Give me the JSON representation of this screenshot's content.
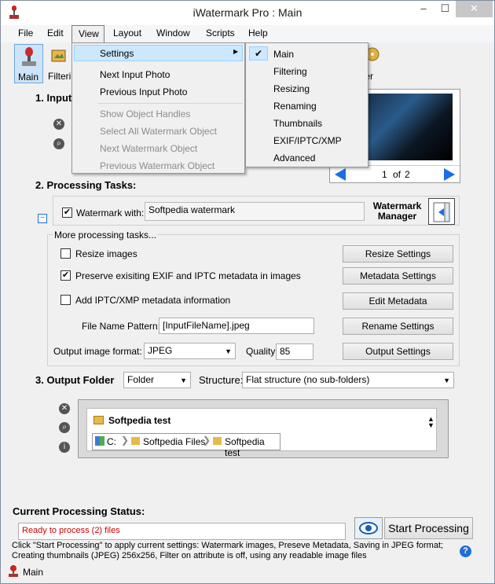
{
  "window": {
    "title": "iWatermark Pro : Main",
    "minimize": "–",
    "maximize": "☐",
    "close": "✕"
  },
  "menu": [
    "File",
    "Edit",
    "View",
    "Layout",
    "Window",
    "Scripts",
    "Help"
  ],
  "toolbar": {
    "main": "Main",
    "filtering": "Filteri",
    "master": "ster"
  },
  "view_menu": {
    "settings": "Settings",
    "next_input": "Next Input Photo",
    "prev_input": "Previous Input Photo",
    "show_handles": "Show Object Handles",
    "select_all": "Select All Watermark Object",
    "next_wm": "Next Watermark Object",
    "prev_wm": "Previous Watermark Object"
  },
  "settings_submenu": [
    "Main",
    "Filtering",
    "Resizing",
    "Renaming",
    "Thumbnails",
    "EXIF/IPTC/XMP",
    "Advanced"
  ],
  "settings_checked": "Main",
  "section1": {
    "title": "1. Input",
    "page": "1",
    "of": "of",
    "total": "2"
  },
  "section2": {
    "title": "2. Processing Tasks:",
    "watermark_label": "Watermark with:",
    "watermark_value": "Softpedia watermark",
    "watermark_manager": "Watermark Manager",
    "more_tasks": "More processing tasks...",
    "resize": "Resize images",
    "preserve": "Preserve exisiting EXIF and IPTC metadata in images",
    "add_iptc": "Add IPTC/XMP metadata information",
    "pattern_label": "File Name Pattern:",
    "pattern_value": "[InputFileName].jpeg",
    "format_label": "Output image format:",
    "format_value": "JPEG",
    "quality_label": "Quality:",
    "quality_value": "85",
    "resize_btn": "Resize Settings",
    "metadata_btn": "Metadata Settings",
    "edit_meta_btn": "Edit Metadata",
    "rename_btn": "Rename Settings",
    "output_btn": "Output Settings",
    "watermark_checked": true,
    "resize_checked": false,
    "preserve_checked": true,
    "add_iptc_checked": false
  },
  "section3": {
    "title": "3. Output Folder",
    "folder_type": "Folder",
    "structure_label": "Structure:",
    "structure_value": "Flat structure (no sub-folders)",
    "folder_name": "Softpedia test",
    "crumbs": [
      "C:",
      "Softpedia Files",
      "Softpedia test"
    ]
  },
  "status": {
    "title": "Current Processing Status:",
    "state": "Ready to process (2) files",
    "start": "Start Processing",
    "help": "?",
    "description": "Click \"Start Processing\" to apply current settings: Watermark images, Preseve Metadata, Saving in JPEG format; Creating thumbnails (JPEG) 256x256, Filter on attribute is off, using any readable image files"
  },
  "statusbar": {
    "label": "Main"
  },
  "colors": {
    "accent": "#1e6fd9",
    "status_red": "#d20000",
    "menu_hl": "#cce8ff",
    "nav_blue": "#1a6ee6"
  }
}
